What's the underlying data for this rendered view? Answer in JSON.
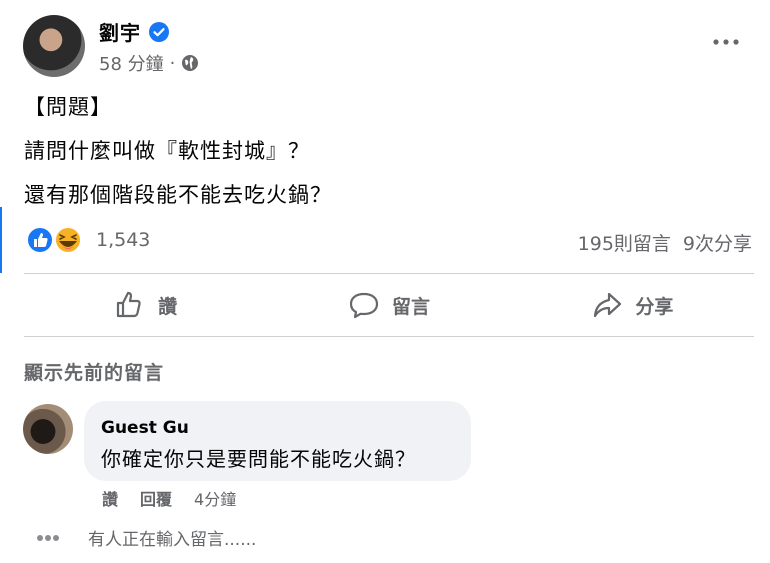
{
  "post": {
    "author": "劉宇",
    "time": "58 分鐘",
    "separator": "·",
    "lines": [
      "【問題】",
      "請問什麼叫做『軟性封城』？",
      "還有那個階段能不能去吃火鍋？"
    ]
  },
  "reactions": {
    "count": "1,543",
    "comments": "195則留言",
    "shares": "9次分享"
  },
  "actions": {
    "like": "讚",
    "comment": "留言",
    "share": "分享"
  },
  "show_previous": "顯示先前的留言",
  "comment": {
    "author": "Guest Gu",
    "text": "你確定你只是要問能不能吃火鍋？",
    "like": "讚",
    "reply": "回覆",
    "time": "4分鐘"
  },
  "typing_status": "有人正在輸入留言......",
  "colors": {
    "accent": "#1877f2",
    "secondary_text": "#65676b",
    "bubble": "#f0f2f5"
  }
}
